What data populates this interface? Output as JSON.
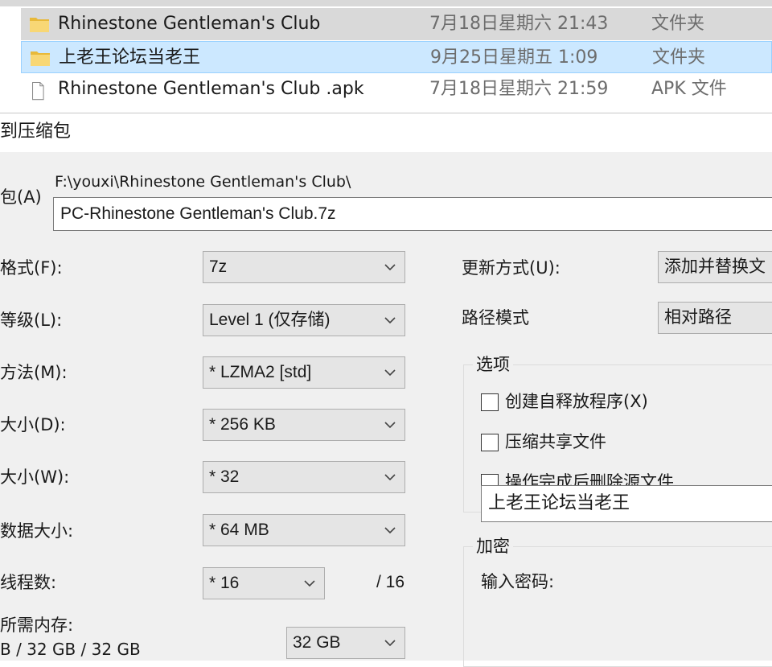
{
  "explorer": {
    "files": [
      {
        "name": "Rhinestone Gentleman's Club",
        "date": "7月18日星期六 21:43",
        "type": "文件夹",
        "icon": "folder-icon"
      },
      {
        "name": "上老王论坛当老王",
        "date": "9月25日星期五 1:09",
        "type": "文件夹",
        "icon": "folder-icon"
      },
      {
        "name": "Rhinestone Gentleman's Club .apk",
        "date": "7月18日星期六 21:59",
        "type": "APK 文件",
        "icon": "file-icon"
      }
    ]
  },
  "dialog": {
    "title": "到压缩包",
    "archive_label": "包(A)",
    "archive_path": "F:\\youxi\\Rhinestone Gentleman's Club\\",
    "archive_name": "PC-Rhinestone Gentleman's Club.7z",
    "left_fields": {
      "format": {
        "label": "格式(F):",
        "value": "7z"
      },
      "level": {
        "label": "等级(L):",
        "value": "Level 1 (仅存储)"
      },
      "method": {
        "label": "方法(M):",
        "value": "*  LZMA2 [std]"
      },
      "dict_size": {
        "label": "大小(D):",
        "value": "*  256 KB"
      },
      "word_size": {
        "label": "大小(W):",
        "value": "*  32"
      },
      "block_size": {
        "label": "数据大小:",
        "value": "*  64 MB"
      },
      "threads": {
        "label": "线程数:",
        "value": "*  16",
        "max": "/ 16"
      },
      "memory": {
        "label": "所需内存:",
        "detail": "B / 32 GB / 32 GB",
        "value": "32 GB"
      }
    },
    "right_fields": {
      "update_mode": {
        "label": "更新方式(U):",
        "value": "添加并替换文"
      },
      "path_mode": {
        "label": "路径模式",
        "value": "相对路径"
      }
    },
    "options": {
      "title": "选项",
      "items": [
        "创建自释放程序(X)",
        "压缩共享文件",
        "操作完成后删除源文件"
      ]
    },
    "encryption": {
      "title": "加密",
      "password_label": "输入密码:",
      "password_value": "上老王论坛当老王"
    }
  },
  "colors": {
    "selected_blue": "#cce8ff",
    "selected_grey": "#d9d9d9",
    "dialog_bg": "#f0f0f0",
    "folder_yellow": "#f8d775"
  }
}
